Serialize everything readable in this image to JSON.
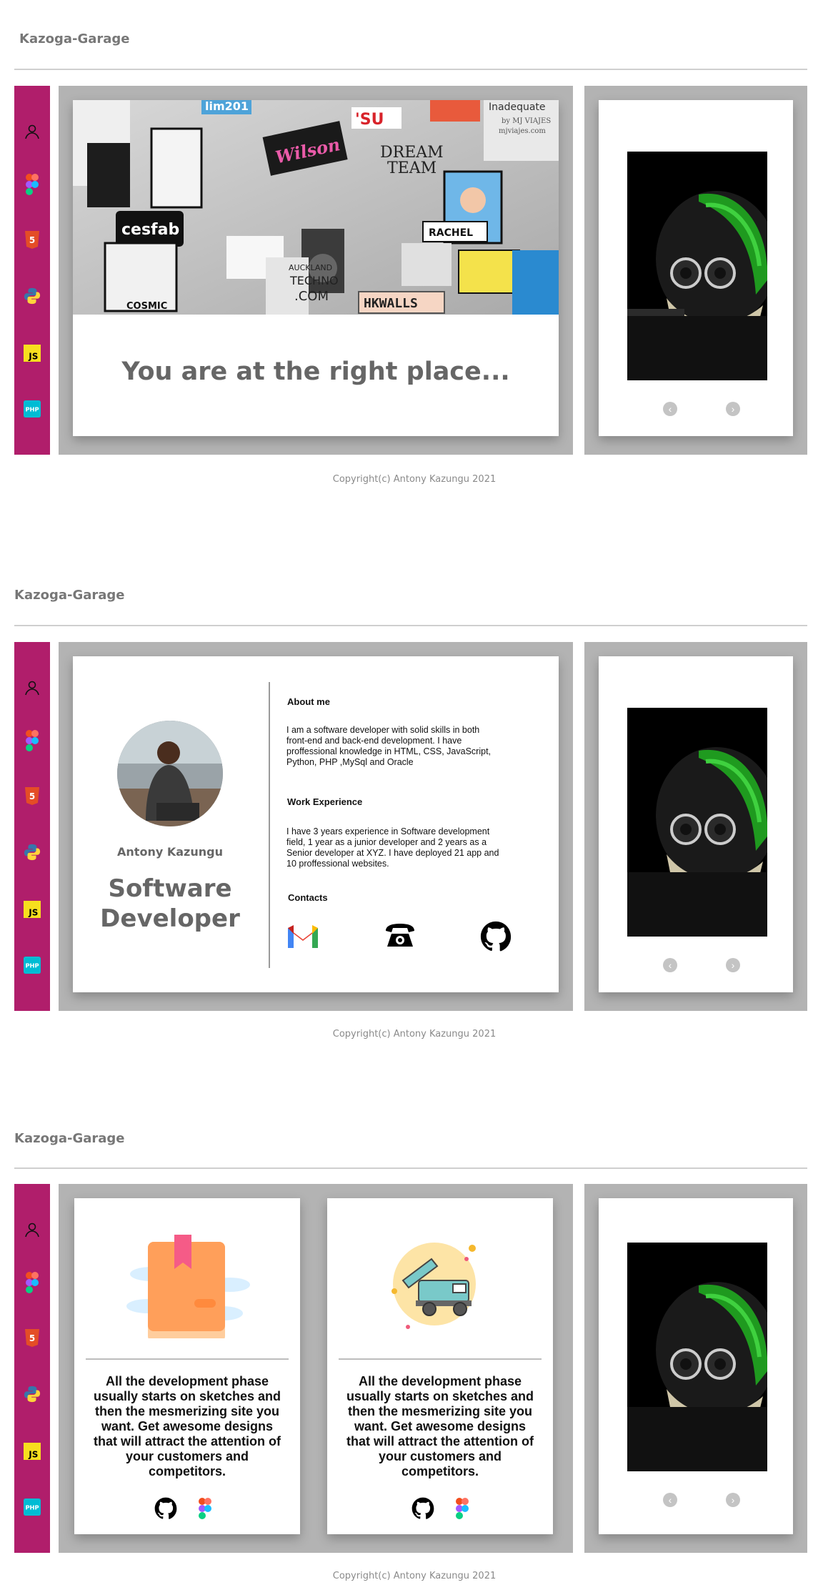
{
  "brand": "Kazoga-Garage",
  "copyright": "Copyright(c) Antony Kazungu 2021",
  "sidebar_icons": [
    "user-icon",
    "figma-icon",
    "html5-icon",
    "python-icon",
    "javascript-icon",
    "php-icon"
  ],
  "sidebar_text": {
    "js": "JS",
    "php": "PHP",
    "html5": "5"
  },
  "hero": {
    "image_text": {
      "top": "lim201",
      "inadequate": "Inadequate",
      "viajes": "by MJ VIAJES",
      "viajes_url": "mjviajes.com",
      "su": "'SU",
      "dream": "DREAM",
      "team": "TEAM",
      "wilson": "Wilson",
      "cesfab": "cesfab",
      "rachel": "RACHEL",
      "auckland": "AUCKLAND",
      "techno": "TECHNO",
      "com": ".COM",
      "hkwalls": "HKWALLS",
      "cosmic": "COSMIC"
    },
    "title": "You are at the right place..."
  },
  "profile": {
    "name": "Antony Kazungu",
    "role_line1": "Software",
    "role_line2": "Developer",
    "about_heading": "About me",
    "about_text": "I am a software developer with solid skills in both front-end and back-end development. I have proffessional knowledge in HTML, CSS, JavaScript, Python, PHP ,MySql and Oracle",
    "work_heading": "Work Experience",
    "work_text": "I have 3 years experience in Software development field, 1 year as a junior developer and 2 years as a Senior developer at XYZ. I have deployed 21 app and 10 proffessional websites.",
    "contacts_heading": "Contacts",
    "contacts": [
      "gmail-icon",
      "telephone-icon",
      "github-icon"
    ]
  },
  "features": [
    {
      "icon": "bookmark-book-icon",
      "text": "All the development phase usually starts on sketches and then the mesmerizing site you want. Get awesome designs that will attract the attention of your customers and competitors.",
      "links": [
        "github-icon",
        "figma-icon"
      ]
    },
    {
      "icon": "airport-stairs-truck-icon",
      "text": "All the development phase usually starts on sketches and then the mesmerizing site you want. Get awesome designs that will attract the attention of your customers and competitors.",
      "links": [
        "github-icon",
        "figma-icon"
      ]
    }
  ],
  "carousel": {
    "prev": "‹",
    "next": "›"
  },
  "colors": {
    "sidebar": "#b01e6b",
    "panel": "#b3b3b3",
    "helmet_accent": "#1f9a1f"
  }
}
